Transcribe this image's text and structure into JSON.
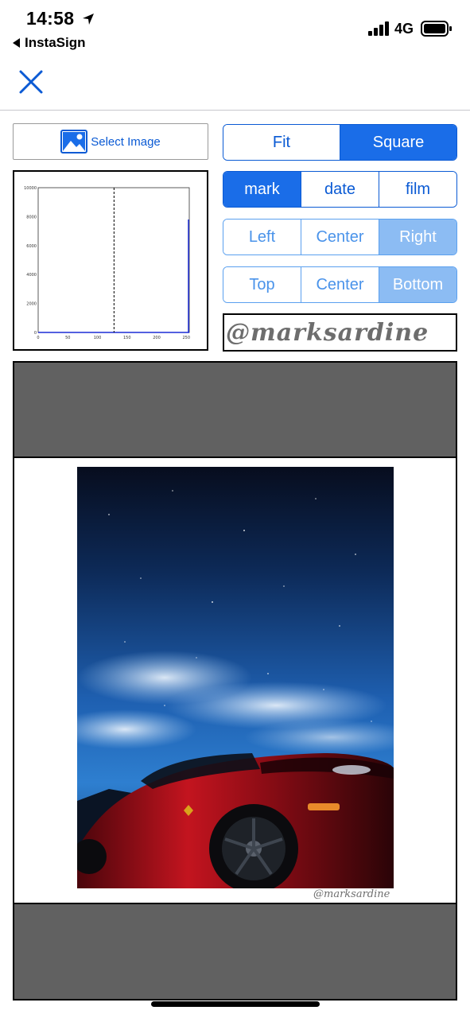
{
  "status_bar": {
    "time": "14:58",
    "back_app": "InstaSign",
    "network": "4G",
    "icons": [
      "location-arrow-icon",
      "signal-icon",
      "battery-icon"
    ]
  },
  "nav": {
    "close_icon": "close-icon"
  },
  "select_image": {
    "label": "Select Image",
    "icon": "image-icon"
  },
  "histogram": {
    "y_ticks": [
      "10000",
      "8000",
      "6000",
      "4000",
      "2000",
      "0"
    ],
    "x_ticks": [
      "0",
      "50",
      "100",
      "150",
      "200",
      "250"
    ],
    "marker_x": 128
  },
  "mode_control": {
    "options": [
      "Fit",
      "Square"
    ],
    "selected": "Square"
  },
  "kind_control": {
    "options": [
      "mark",
      "date",
      "film"
    ],
    "selected": "mark"
  },
  "h_align_control": {
    "options": [
      "Left",
      "Center",
      "Right"
    ],
    "selected": "Right"
  },
  "v_align_control": {
    "options": [
      "Top",
      "Center",
      "Bottom"
    ],
    "selected": "Bottom"
  },
  "watermark_preview": {
    "text": "@marksardine"
  },
  "preview": {
    "watermark": "@marksardine",
    "colors": {
      "padding": "#616161",
      "sky": "#1e5fb0",
      "car": "#b3121e"
    }
  },
  "colors": {
    "accent": "#0a5ad4",
    "accent_fill": "#1a6de8",
    "accent_light": "#8cbcf3"
  }
}
